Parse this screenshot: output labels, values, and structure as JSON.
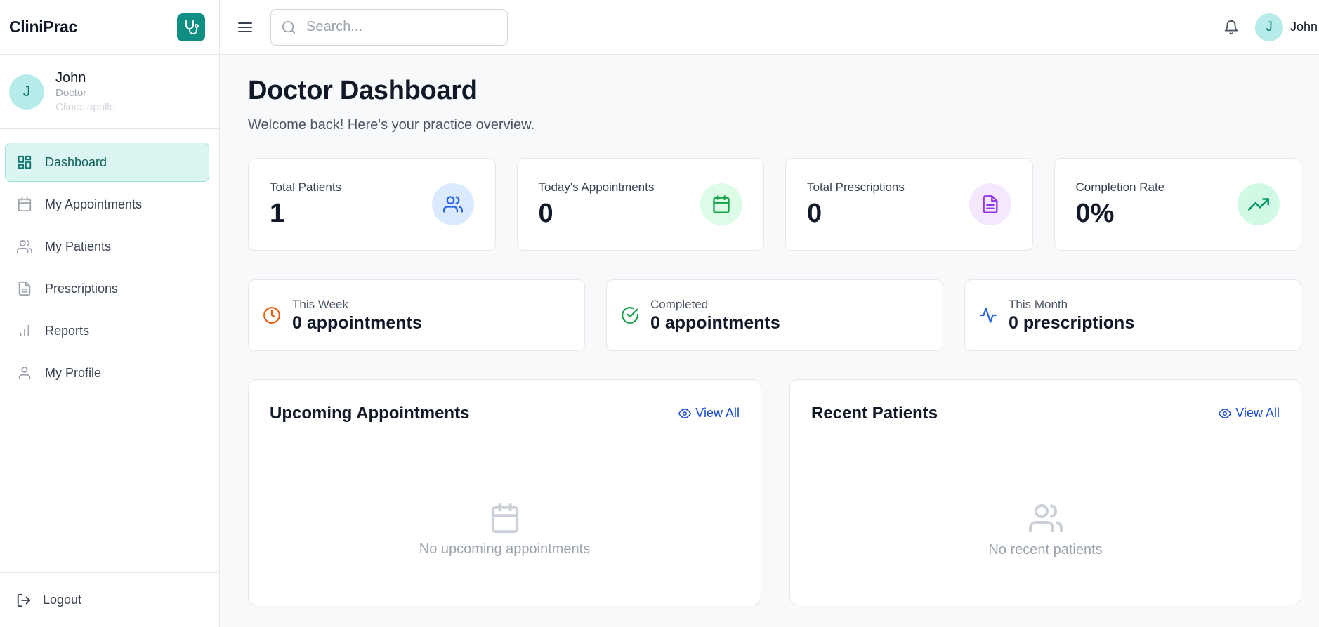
{
  "app": {
    "name": "CliniPrac"
  },
  "sidebar": {
    "user": {
      "initial": "J",
      "name": "John",
      "role": "Doctor",
      "clinic": "Clinic: apollo"
    },
    "items": [
      {
        "label": "Dashboard",
        "icon": "dashboard-icon",
        "active": true
      },
      {
        "label": "My Appointments",
        "icon": "calendar-icon"
      },
      {
        "label": "My Patients",
        "icon": "users-icon"
      },
      {
        "label": "Prescriptions",
        "icon": "file-icon"
      },
      {
        "label": "Reports",
        "icon": "bar-chart-icon"
      },
      {
        "label": "My Profile",
        "icon": "user-icon"
      }
    ],
    "logout_label": "Logout"
  },
  "header": {
    "search_placeholder": "Search...",
    "user_initial": "J",
    "user_name": "John"
  },
  "page": {
    "title": "Doctor Dashboard",
    "subtitle": "Welcome back! Here's your practice overview."
  },
  "stats": [
    {
      "label": "Total Patients",
      "value": "1",
      "icon": "users-icon",
      "color": "#2563eb",
      "bg": "#dbeafe"
    },
    {
      "label": "Today's Appointments",
      "value": "0",
      "icon": "calendar-icon",
      "color": "#16a34a",
      "bg": "#dcfce7"
    },
    {
      "label": "Total Prescriptions",
      "value": "0",
      "icon": "file-icon",
      "color": "#9333ea",
      "bg": "#f3e8ff"
    },
    {
      "label": "Completion Rate",
      "value": "0%",
      "icon": "trending-up-icon",
      "color": "#059669",
      "bg": "#d1fae5"
    }
  ],
  "mini": [
    {
      "label": "This Week",
      "value": "0 appointments",
      "icon": "clock-icon",
      "color": "#ea580c"
    },
    {
      "label": "Completed",
      "value": "0 appointments",
      "icon": "check-circle-icon",
      "color": "#16a34a"
    },
    {
      "label": "This Month",
      "value": "0 prescriptions",
      "icon": "activity-icon",
      "color": "#2563eb"
    }
  ],
  "panels": {
    "appointments": {
      "title": "Upcoming Appointments",
      "view_all": "View All",
      "empty": "No upcoming appointments",
      "empty_icon": "calendar-icon"
    },
    "patients": {
      "title": "Recent Patients",
      "view_all": "View All",
      "empty": "No recent patients",
      "empty_icon": "users-icon"
    }
  },
  "colors": {
    "accent": "#0f8f84",
    "link": "#1d4ed8"
  }
}
